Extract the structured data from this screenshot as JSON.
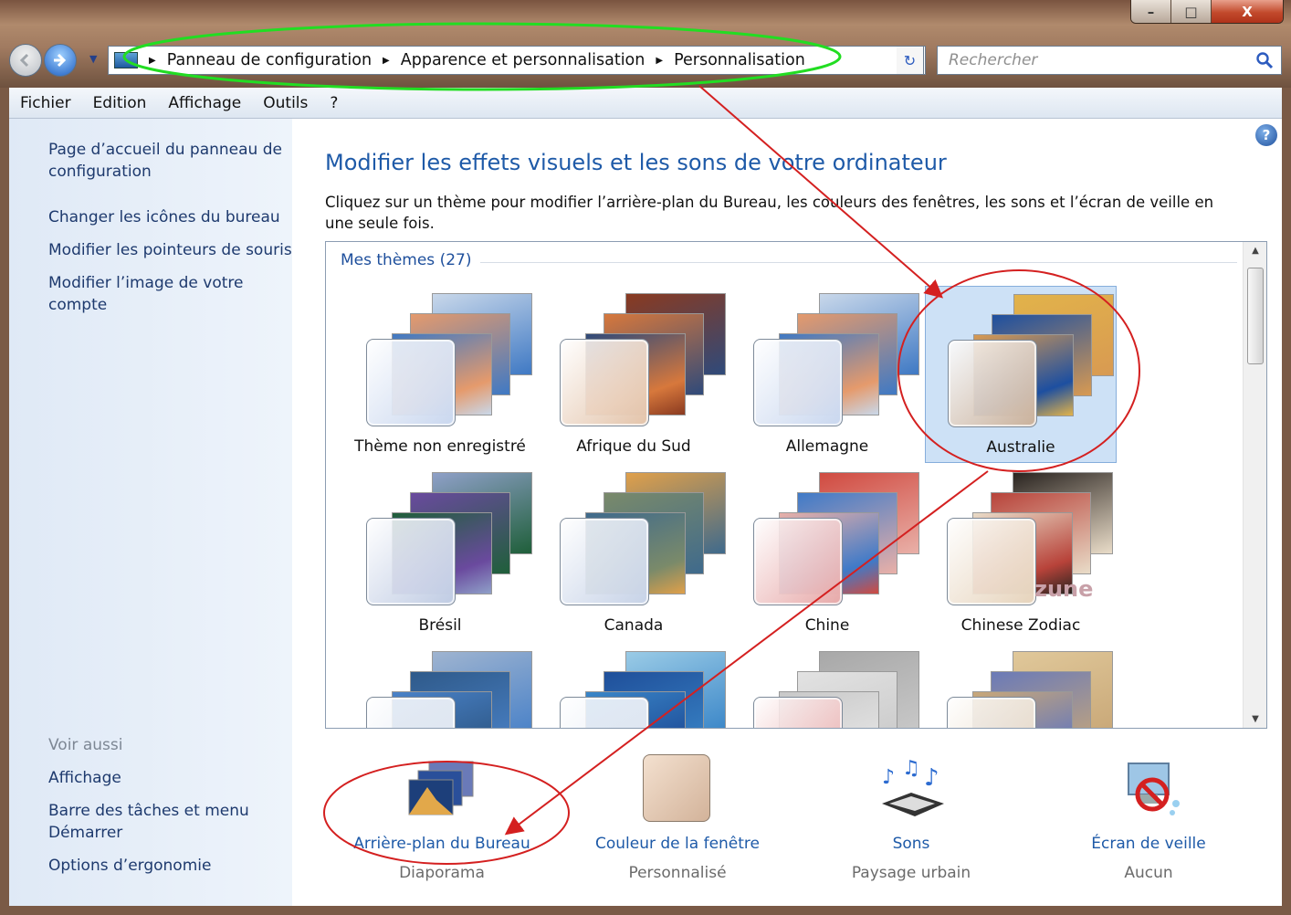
{
  "window": {
    "min_label": "–",
    "max_label": "□",
    "close_label": "X"
  },
  "nav": {
    "breadcrumb": [
      "Panneau de configuration",
      "Apparence et personnalisation",
      "Personnalisation"
    ],
    "search_placeholder": "Rechercher"
  },
  "menu": [
    "Fichier",
    "Edition",
    "Affichage",
    "Outils",
    "?"
  ],
  "sidebar": {
    "links": [
      "Page d’accueil du panneau de configuration",
      "Changer les icônes du bureau",
      "Modifier les pointeurs de souris",
      "Modifier l’image de votre compte"
    ],
    "see_also_title": "Voir aussi",
    "see_also": [
      "Affichage",
      "Barre des tâches et menu Démarrer",
      "Options d’ergonomie"
    ]
  },
  "main": {
    "help_label": "?",
    "title": "Modifier les effets visuels et les sons de votre ordinateur",
    "description": "Cliquez sur un thème pour modifier l’arrière-plan du Bureau, les couleurs des fenêtres, les sons et l’écran de veille en une seule fois.",
    "group_title": "Mes thèmes (27)",
    "themes": [
      {
        "name": "Thème non enregistré",
        "selected": false,
        "palette": [
          "#3f79c4",
          "#e59a6c",
          "#c9d8ea"
        ],
        "glass": "#c9d7ef"
      },
      {
        "name": "Afrique du Sud",
        "selected": false,
        "palette": [
          "#2f4a7a",
          "#d7783c",
          "#8a3a20"
        ],
        "glass": "#e3c3a9"
      },
      {
        "name": "Allemagne",
        "selected": false,
        "palette": [
          "#3f79c4",
          "#e59a6c",
          "#c9d8ea"
        ],
        "glass": "#c9d7ef"
      },
      {
        "name": "Australie",
        "selected": true,
        "palette": [
          "#d89a52",
          "#1d4fa0",
          "#e2b34a"
        ],
        "glass": "#c9b09a"
      },
      {
        "name": "Brésil",
        "selected": false,
        "palette": [
          "#1f5f3a",
          "#6a4a9e",
          "#8fa0c8"
        ],
        "glass": "#bfcbe3"
      },
      {
        "name": "Canada",
        "selected": false,
        "palette": [
          "#3f6a8c",
          "#7a8a6a",
          "#e0a04a"
        ],
        "glass": "#c6d2e7"
      },
      {
        "name": "Chine",
        "selected": false,
        "palette": [
          "#e9b0a8",
          "#3f7ac8",
          "#d04a40"
        ],
        "glass": "#e7a8a8"
      },
      {
        "name": "Chinese Zodiac",
        "selected": false,
        "palette": [
          "#e9dcc8",
          "#b8433a",
          "#2a2420"
        ],
        "glass": "#e6d3bb"
      },
      {
        "name": "",
        "selected": false,
        "palette": [
          "#4a82c8",
          "#2f5a8a",
          "#9fb4d0"
        ],
        "glass": "#dfe6f2"
      },
      {
        "name": "",
        "selected": false,
        "palette": [
          "#3a86c8",
          "#1f4f9a",
          "#9acbe6"
        ],
        "glass": "#dfe6f2"
      },
      {
        "name": "",
        "selected": false,
        "palette": [
          "#c8c8c8",
          "#e2e2e2",
          "#a8a8a8"
        ],
        "glass": "#e8a8a8"
      },
      {
        "name": "",
        "selected": false,
        "palette": [
          "#c9a878",
          "#6a7ab8",
          "#e0c89a"
        ],
        "glass": "#e6d6c0"
      }
    ],
    "watermark": "zune",
    "options": [
      {
        "label": "Arrière-plan du Bureau",
        "sub": "Diaporama",
        "icon": "desktop-background-icon"
      },
      {
        "label": "Couleur de la fenêtre",
        "sub": "Personnalisé",
        "icon": "window-color-icon"
      },
      {
        "label": "Sons",
        "sub": "Paysage urbain",
        "icon": "sounds-icon"
      },
      {
        "label": "Écran de veille",
        "sub": "Aucun",
        "icon": "screensaver-icon"
      }
    ]
  },
  "colors": {
    "accent": "#1e5aa8",
    "annotation_green": "#22dd22",
    "annotation_red": "#d42020"
  }
}
